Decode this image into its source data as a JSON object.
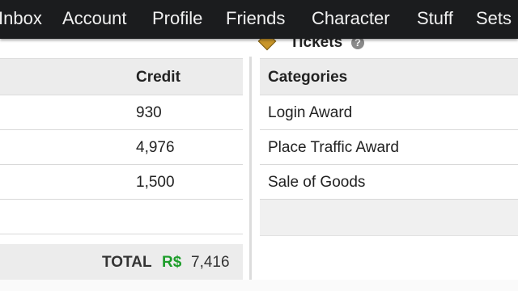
{
  "nav": {
    "items": [
      {
        "label": "Inbox"
      },
      {
        "label": "Account"
      },
      {
        "label": "Profile"
      },
      {
        "label": "Friends"
      },
      {
        "label": "Character"
      },
      {
        "label": "Stuff"
      },
      {
        "label": "Sets"
      }
    ]
  },
  "tickets": {
    "label": "Tickets",
    "help": "?"
  },
  "left_table": {
    "header": {
      "credit": "Credit"
    },
    "rows": [
      {
        "credit": "930"
      },
      {
        "credit": "4,976"
      },
      {
        "credit": "1,500"
      }
    ]
  },
  "total": {
    "label": "TOTAL",
    "currency": "R$",
    "value": "7,416"
  },
  "right_table": {
    "header": {
      "categories": "Categories"
    },
    "rows": [
      {
        "category": "Login Award"
      },
      {
        "category": "Place Traffic Award"
      },
      {
        "category": "Sale of Goods"
      }
    ]
  },
  "colors": {
    "nav_bg": "#1b1c1e",
    "currency_green": "#1d9d2a",
    "header_bg": "#ececec"
  }
}
